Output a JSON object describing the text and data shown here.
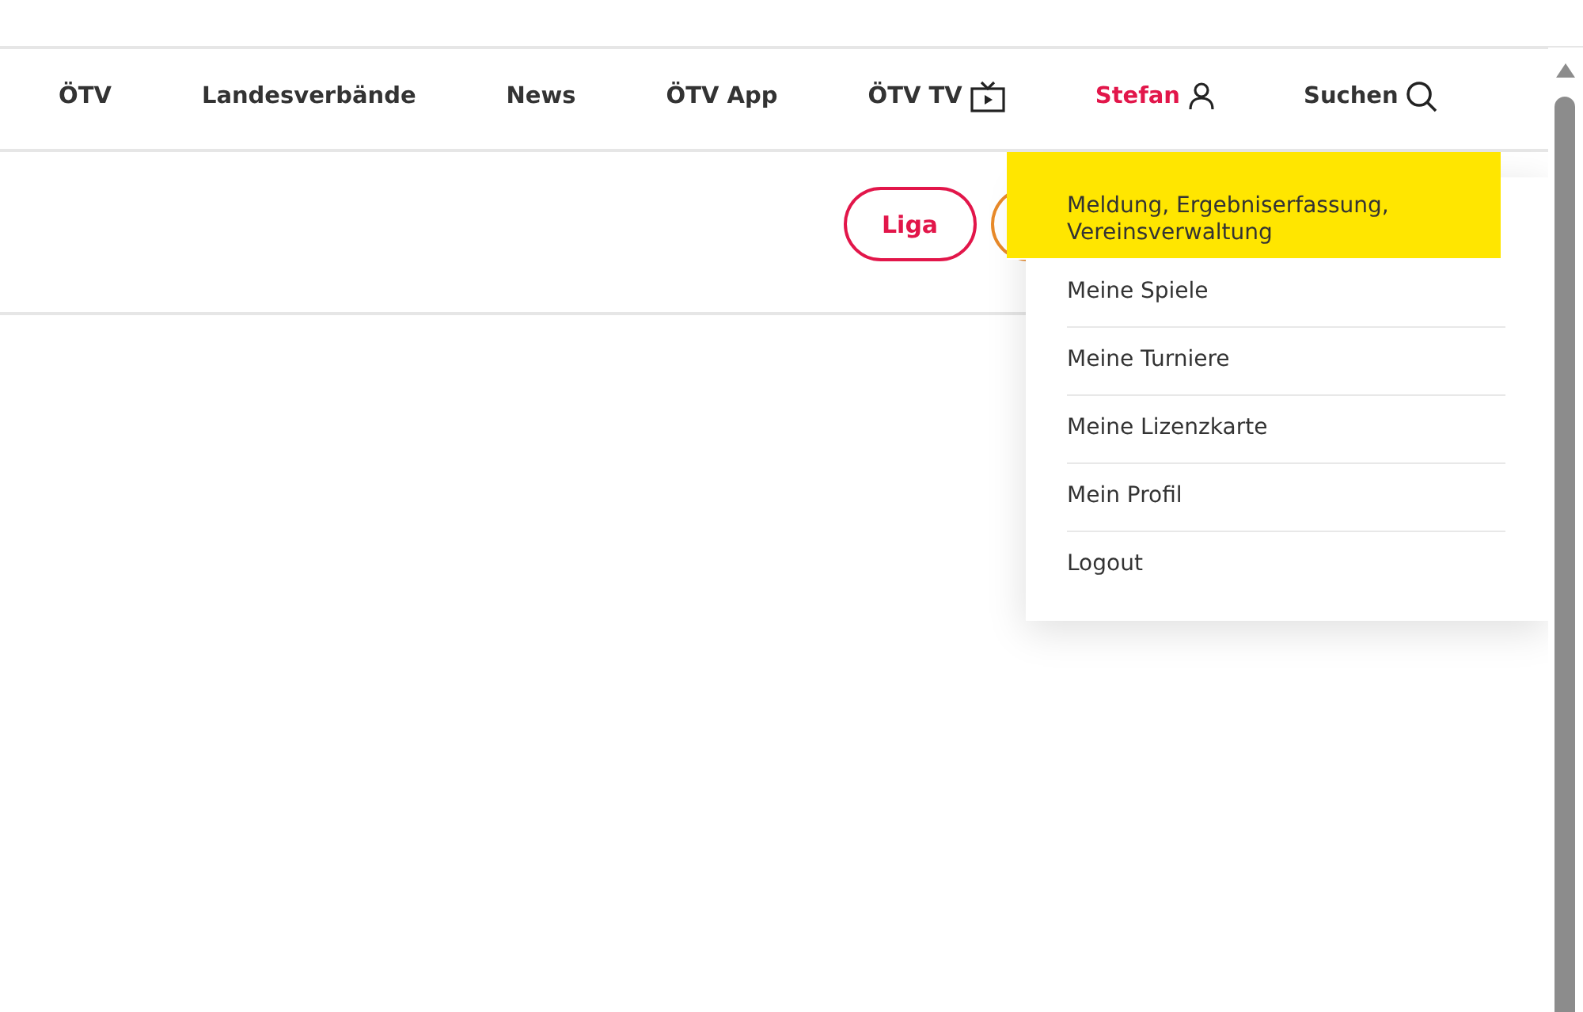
{
  "nav": {
    "items": [
      {
        "label": "ÖTV",
        "kind": "link",
        "selected": false
      },
      {
        "label": "Landesverbände",
        "kind": "link",
        "selected": false
      },
      {
        "label": "News",
        "kind": "link",
        "selected": false
      },
      {
        "label": "ÖTV App",
        "kind": "link",
        "selected": false
      },
      {
        "label": "ÖTV TV",
        "kind": "tv",
        "selected": false
      },
      {
        "label": "Stefan",
        "kind": "account",
        "selected": true
      },
      {
        "label": "Suchen",
        "kind": "search",
        "selected": false
      }
    ]
  },
  "subnav": {
    "buttons": [
      {
        "label": "Liga"
      }
    ]
  },
  "user_menu": {
    "items": [
      {
        "label": "Meldung, Ergebniserfassung, Vereinsverwaltung",
        "highlighted": true
      },
      {
        "label": "Meine Spiele",
        "highlighted": false
      },
      {
        "label": "Meine Turniere",
        "highlighted": false
      },
      {
        "label": "Meine Lizenzkarte",
        "highlighted": false
      },
      {
        "label": "Mein Profil",
        "highlighted": false
      },
      {
        "label": "Logout",
        "highlighted": false
      }
    ]
  }
}
